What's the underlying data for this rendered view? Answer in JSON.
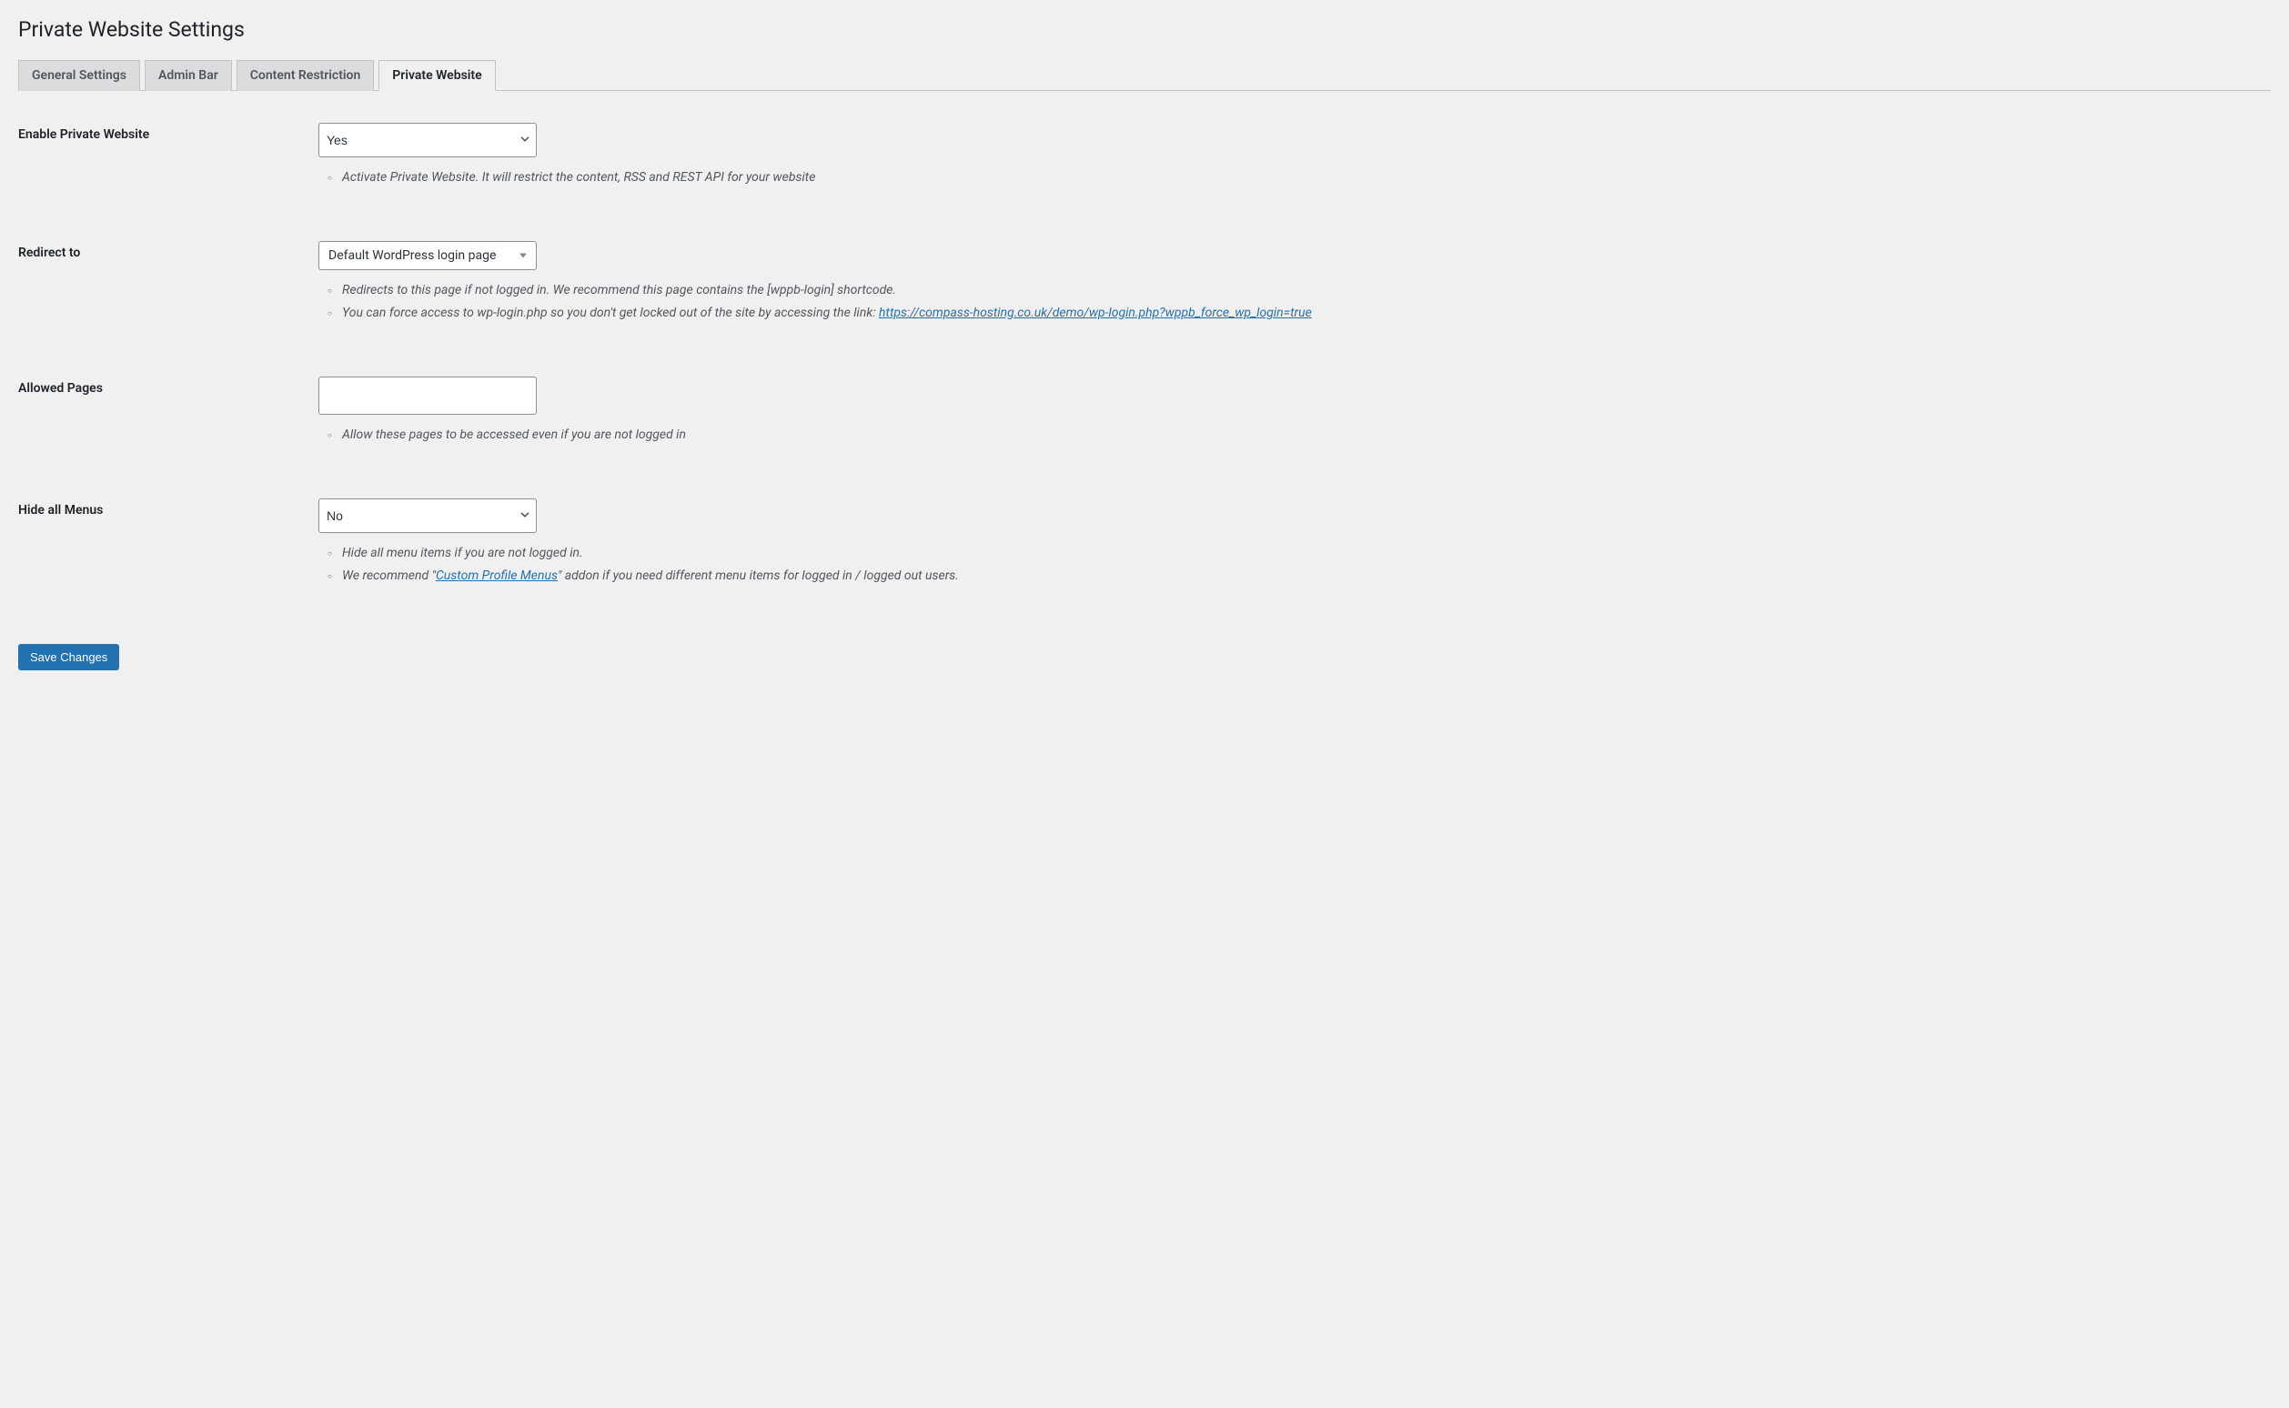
{
  "page_title": "Private Website Settings",
  "tabs": [
    {
      "label": "General Settings",
      "active": false
    },
    {
      "label": "Admin Bar",
      "active": false
    },
    {
      "label": "Content Restriction",
      "active": false
    },
    {
      "label": "Private Website",
      "active": true
    }
  ],
  "fields": {
    "enable_private_website": {
      "label": "Enable Private Website",
      "value": "Yes",
      "description": "Activate Private Website. It will restrict the content, RSS and REST API for your website"
    },
    "redirect_to": {
      "label": "Redirect to",
      "value": "Default WordPress login page",
      "description_1": "Redirects to this page if not logged in. We recommend this page contains the [wppb-login] shortcode.",
      "description_2_prefix": "You can force access to wp-login.php so you don't get locked out of the site by accessing the link: ",
      "description_2_link": "https://compass-hosting.co.uk/demo/wp-login.php?wppb_force_wp_login=true"
    },
    "allowed_pages": {
      "label": "Allowed Pages",
      "value": "",
      "description": "Allow these pages to be accessed even if you are not logged in"
    },
    "hide_all_menus": {
      "label": "Hide all Menus",
      "value": "No",
      "description_1": "Hide all menu items if you are not logged in.",
      "description_2_prefix": "We recommend \"",
      "description_2_link": "Custom Profile Menus",
      "description_2_suffix": "\" addon if you need different menu items for logged in / logged out users."
    }
  },
  "save_button": "Save Changes"
}
